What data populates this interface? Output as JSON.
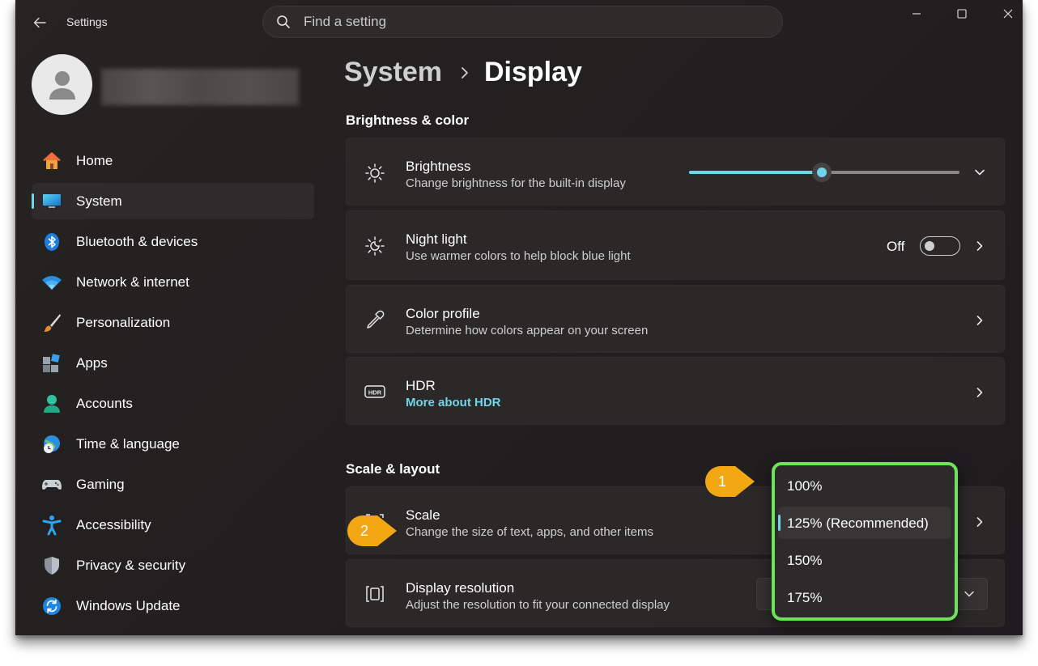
{
  "app": {
    "title": "Settings",
    "search_placeholder": "Find a setting"
  },
  "sidebar": {
    "items": [
      {
        "label": "Home",
        "icon": "home-icon",
        "selected": false
      },
      {
        "label": "System",
        "icon": "monitor-icon",
        "selected": true
      },
      {
        "label": "Bluetooth & devices",
        "icon": "bluetooth-icon",
        "selected": false
      },
      {
        "label": "Network & internet",
        "icon": "wifi-icon",
        "selected": false
      },
      {
        "label": "Personalization",
        "icon": "brush-icon",
        "selected": false
      },
      {
        "label": "Apps",
        "icon": "apps-icon",
        "selected": false
      },
      {
        "label": "Accounts",
        "icon": "person-icon",
        "selected": false
      },
      {
        "label": "Time & language",
        "icon": "globe-clock-icon",
        "selected": false
      },
      {
        "label": "Gaming",
        "icon": "gamepad-icon",
        "selected": false
      },
      {
        "label": "Accessibility",
        "icon": "accessibility-icon",
        "selected": false
      },
      {
        "label": "Privacy & security",
        "icon": "shield-icon",
        "selected": false
      },
      {
        "label": "Windows Update",
        "icon": "update-icon",
        "selected": false
      }
    ]
  },
  "breadcrumb": {
    "parent": "System",
    "current": "Display"
  },
  "sections": {
    "brightness_color": "Brightness & color",
    "scale_layout": "Scale & layout"
  },
  "cards": {
    "brightness": {
      "title": "Brightness",
      "subtitle": "Change brightness for the built-in display",
      "value_fraction": 0.49
    },
    "night_light": {
      "title": "Night light",
      "subtitle": "Use warmer colors to help block blue light",
      "toggle_label": "Off"
    },
    "color_profile": {
      "title": "Color profile",
      "subtitle": "Determine how colors appear on your screen"
    },
    "hdr": {
      "title": "HDR",
      "link": "More about HDR"
    },
    "scale": {
      "title": "Scale",
      "subtitle": "Change the size of text, apps, and other items"
    },
    "display_resolution": {
      "title": "Display resolution",
      "subtitle": "Adjust the resolution to fit your connected display"
    }
  },
  "scale_dropdown": {
    "options": [
      {
        "label": "100%",
        "selected": false
      },
      {
        "label": "125% (Recommended)",
        "selected": true
      },
      {
        "label": "150%",
        "selected": false
      },
      {
        "label": "175%",
        "selected": false
      }
    ]
  },
  "callouts": [
    "1",
    "2"
  ],
  "colors": {
    "accent": "#72d4e8",
    "highlight": "#6ee35a",
    "callout": "#f3a712"
  }
}
